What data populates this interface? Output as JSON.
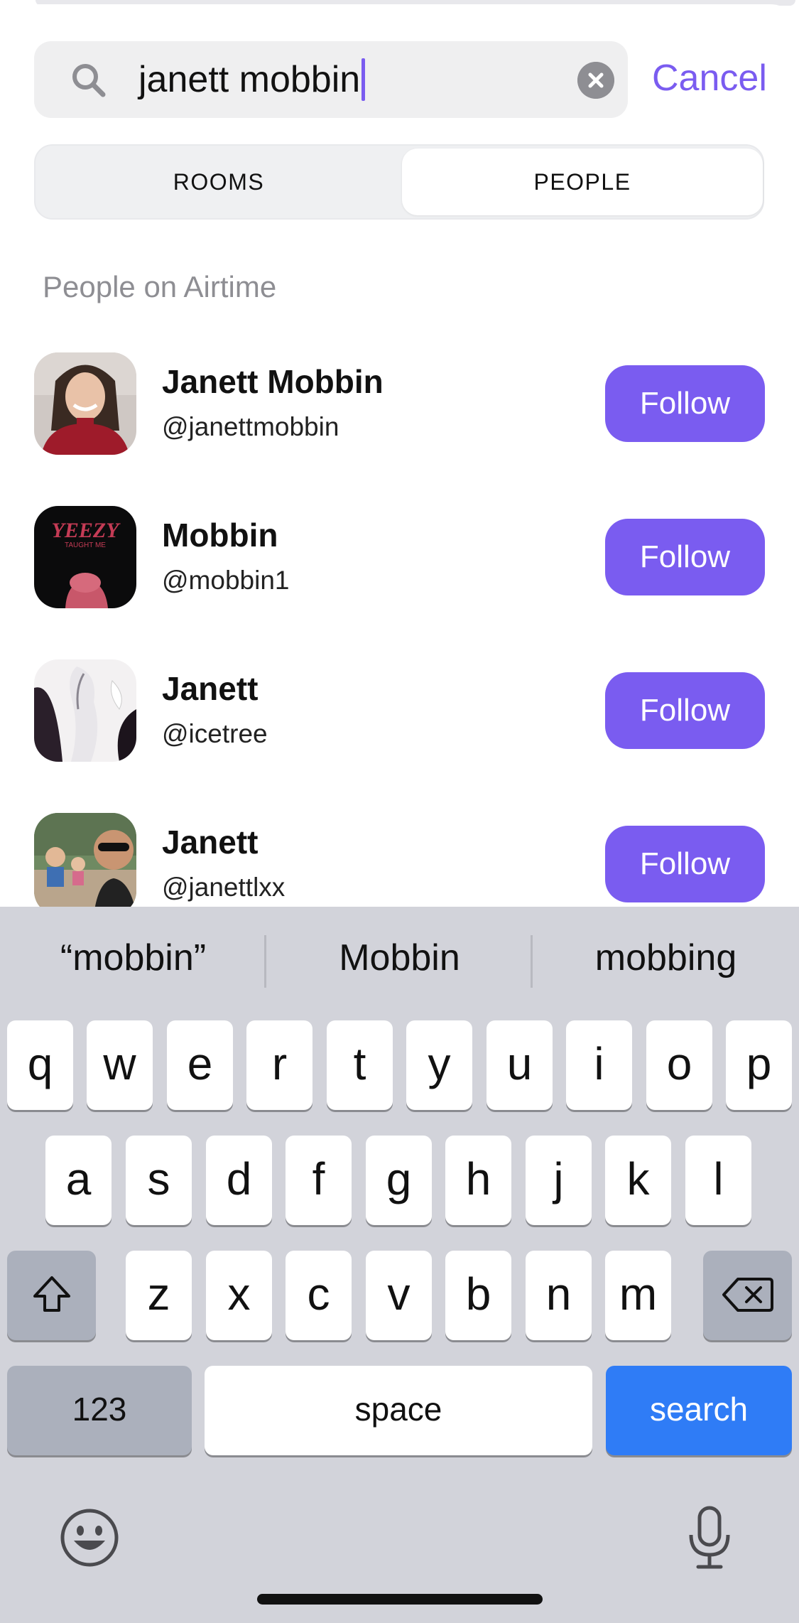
{
  "search": {
    "value": "janett mobbin",
    "cancel_label": "Cancel"
  },
  "segments": {
    "rooms": "ROOMS",
    "people": "PEOPLE",
    "selected": "PEOPLE"
  },
  "section_title": "People on Airtime",
  "people": [
    {
      "name": "Janett Mobbin",
      "handle": "@janettmobbin",
      "button": "Follow"
    },
    {
      "name": "Mobbin",
      "handle": "@mobbin1",
      "button": "Follow"
    },
    {
      "name": "Janett",
      "handle": "@icetree",
      "button": "Follow"
    },
    {
      "name": "Janett",
      "handle": "@janettlxx",
      "button": "Follow"
    }
  ],
  "avatar_2_text": {
    "line1": "YEEZY",
    "line2": "TAUGHT ME"
  },
  "keyboard": {
    "suggestions": [
      "“mobbin”",
      "Mobbin",
      "mobbing"
    ],
    "row1": [
      "q",
      "w",
      "e",
      "r",
      "t",
      "y",
      "u",
      "i",
      "o",
      "p"
    ],
    "row2": [
      "a",
      "s",
      "d",
      "f",
      "g",
      "h",
      "j",
      "k",
      "l"
    ],
    "row3": [
      "z",
      "x",
      "c",
      "v",
      "b",
      "n",
      "m"
    ],
    "numbers_key": "123",
    "space_key": "space",
    "return_key": "search"
  },
  "colors": {
    "accent": "#7a5cf0",
    "return_key": "#2f7cf6"
  }
}
